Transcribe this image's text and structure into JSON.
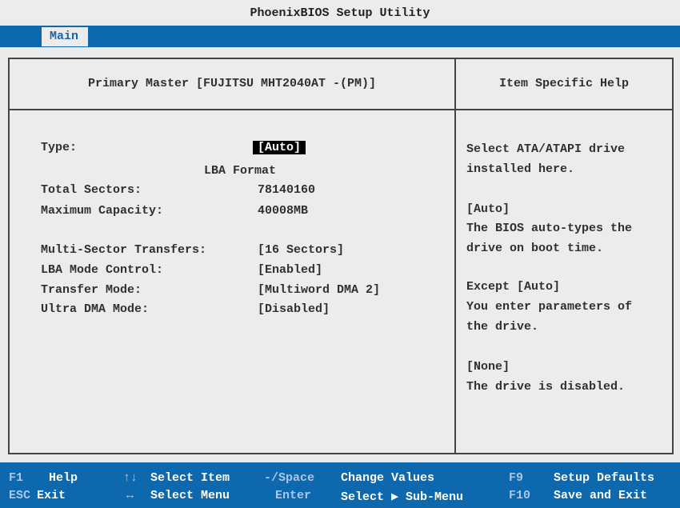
{
  "app": {
    "title": "PhoenixBIOS Setup Utility"
  },
  "menu": {
    "active_tab": "Main"
  },
  "main": {
    "header": "Primary Master [FUJITSU MHT2040AT -(PM)]",
    "type_label": "Type:",
    "type_value": "[Auto]",
    "lba_format": "LBA Format",
    "total_sectors_label": "Total Sectors:",
    "total_sectors_value": "78140160",
    "max_capacity_label": "Maximum Capacity:",
    "max_capacity_value": "40008MB",
    "multi_sector_label": "Multi-Sector Transfers:",
    "multi_sector_value": "[16 Sectors]",
    "lba_mode_label": "LBA Mode Control:",
    "lba_mode_value": "[Enabled]",
    "transfer_mode_label": "Transfer Mode:",
    "transfer_mode_value": "[Multiword DMA 2]",
    "udma_label": "Ultra DMA Mode:",
    "udma_value": "[Disabled]"
  },
  "help": {
    "header": "Item Specific Help",
    "lines": [
      "Select ATA/ATAPI drive",
      "installed here.",
      "[Auto]",
      "The BIOS auto-types the",
      "drive on boot time.",
      "Except [Auto]",
      "You enter parameters of",
      "the drive.",
      "[None]",
      "The drive is disabled."
    ]
  },
  "footer": {
    "f1_key": "F1",
    "f1_desc": "Help",
    "updown_key": "↑↓",
    "updown_desc": "Select Item",
    "minus_space_key": "-/Space",
    "minus_space_desc": "Change Values",
    "f9_key": "F9",
    "f9_desc": "Setup Defaults",
    "esc_key": "ESC",
    "esc_desc": "Exit",
    "leftright_key": "↔",
    "leftright_desc": "Select Menu",
    "enter_key": "Enter",
    "enter_desc": "Select ▶ Sub-Menu",
    "f10_key": "F10",
    "f10_desc": "Save and Exit"
  },
  "colors": {
    "accent_blue": "#0d68ad",
    "panel_bg": "#ececec"
  }
}
